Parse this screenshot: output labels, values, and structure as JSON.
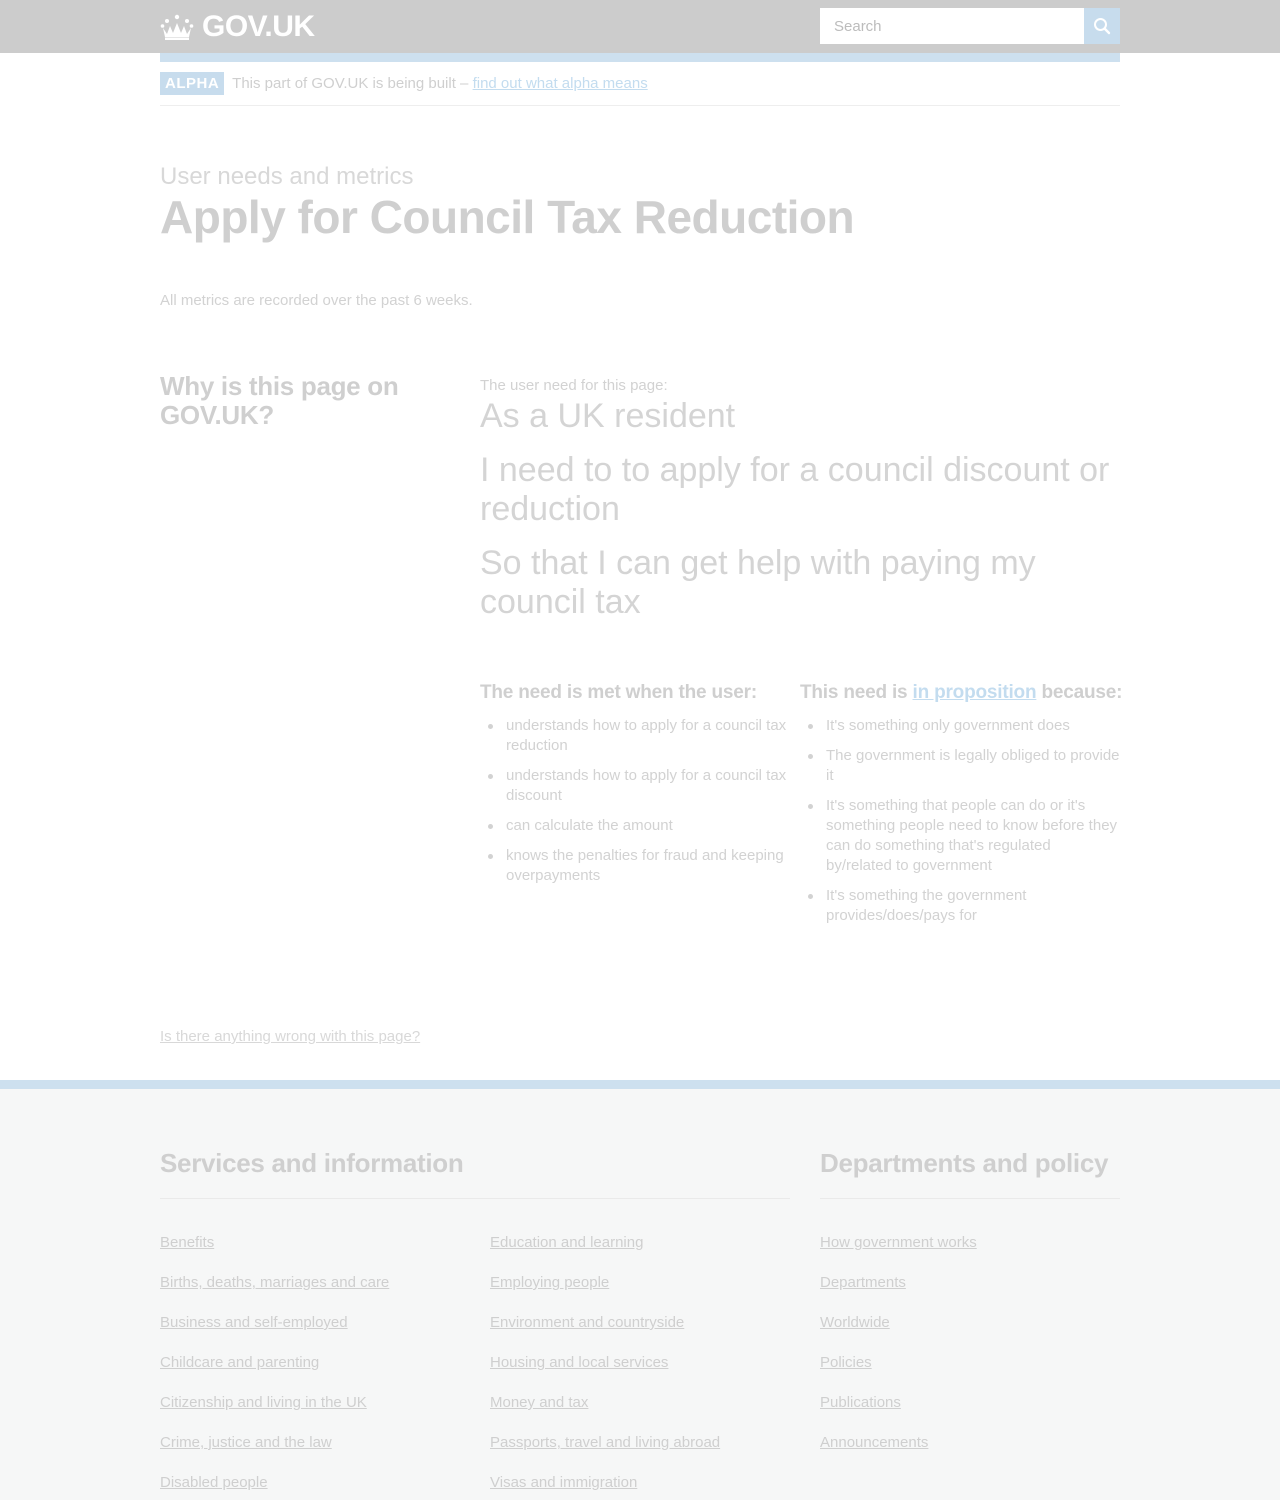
{
  "header": {
    "logo_text": "GOV.UK",
    "search_placeholder": "Search"
  },
  "phase_banner": {
    "tag": "ALPHA",
    "text": "This part of GOV.UK is being built – ",
    "link": "find out what alpha means"
  },
  "page": {
    "kicker": "User needs and metrics",
    "title": "Apply for Council Tax Reduction",
    "metrics_note": "All metrics are recorded over the past 6 weeks.",
    "why_heading": "Why is this page on GOV.UK?"
  },
  "user_need": {
    "label": "The user need for this page:",
    "as_a": "As a UK resident",
    "i_need": "I need to to apply for a council discount or reduction",
    "so_that": "So that I can get help with paying my council tax"
  },
  "met_when": {
    "heading": "The need is met when the user:",
    "items": [
      "understands how to apply for a council tax reduction",
      "understands how to apply for a council tax discount",
      "can calculate the amount",
      "knows the penalties for fraud and keeping overpayments"
    ]
  },
  "proposition": {
    "heading_prefix": "This need is ",
    "heading_link": "in proposition",
    "heading_suffix": " because:",
    "items": [
      "It's something only government does",
      "The government is legally obliged to provide it",
      "It's something that people can do or it's something people need to know before they can do something that's regulated by/related to government",
      "It's something the government provides/does/pays for"
    ]
  },
  "report_link": "Is there anything wrong with this page?",
  "footer": {
    "services_heading": "Services and information",
    "services_col1": [
      "Benefits",
      "Births, deaths, marriages and care",
      "Business and self-employed",
      "Childcare and parenting",
      "Citizenship and living in the UK",
      "Crime, justice and the law",
      "Disabled people"
    ],
    "services_col2": [
      "Education and learning",
      "Employing people",
      "Environment and countryside",
      "Housing and local services",
      "Money and tax",
      "Passports, travel and living abroad",
      "Visas and immigration"
    ],
    "departments_heading": "Departments and policy",
    "departments": [
      "How government works",
      "Departments",
      "Worldwide",
      "Policies",
      "Publications",
      "Announcements"
    ]
  },
  "colors": {
    "header_bg": "#cccccc",
    "accent_blue": "#cde0ef",
    "footer_bg": "#f6f7f7"
  }
}
